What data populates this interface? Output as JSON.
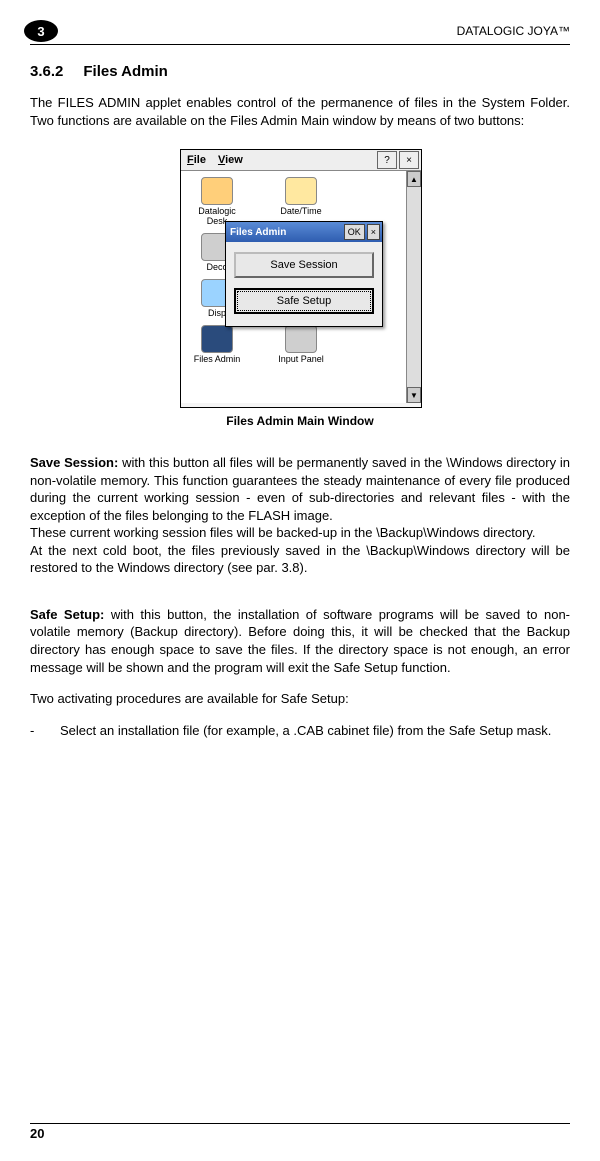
{
  "header": {
    "chapter_number": "3",
    "doc_title": "DATALOGIC JOYA™"
  },
  "section": {
    "number": "3.6.2",
    "title": "Files Admin"
  },
  "intro": "The FILES ADMIN applet enables control of the permanence of files in the System Folder. Two functions are available on the Files Admin Main window by means of two buttons:",
  "screenshot": {
    "menu_file": "File",
    "menu_view": "View",
    "help_btn": "?",
    "close_btn": "×",
    "scroll_up": "▲",
    "scroll_down": "▼",
    "icons": {
      "datalogic": "Datalogic\nDesk",
      "datetime": "Date/Time",
      "deco": "Deco",
      "disp": "Disp",
      "filesadmin": "Files Admin",
      "inputpanel": "Input Panel"
    },
    "dialog": {
      "title": "Files Admin",
      "ok": "OK",
      "close": "×",
      "btn_save": "Save Session",
      "btn_safe": "Safe Setup"
    }
  },
  "caption": "Files Admin Main Window",
  "save_session": {
    "label": "Save Session:",
    "p1": " with this button all files will be permanently saved in the \\Windows directory in non-volatile memory. This function guarantees the steady maintenance of every file produced during the current working session - even of sub-directories and relevant files - with the exception of the files belonging to the FLASH image.",
    "p2": "These current working session files will be backed-up in the \\Backup\\Windows directory.",
    "p3": "At the next cold boot, the files previously saved in the \\Backup\\Windows directory will be restored to the Windows directory (see par. 3.8)."
  },
  "safe_setup": {
    "label": "Safe Setup:",
    "p1": " with this button, the installation of software programs will be saved to non-volatile memory (Backup directory). Before doing this, it will be checked that the Backup directory has enough space to save the files. If the directory space is not enough, an error message will be shown and the program will exit the Safe Setup function.",
    "p2": "Two activating procedures are available for Safe Setup:",
    "bullet": "Select an installation file (for example, a .CAB cabinet file) from the Safe Setup mask."
  },
  "page_number": "20"
}
